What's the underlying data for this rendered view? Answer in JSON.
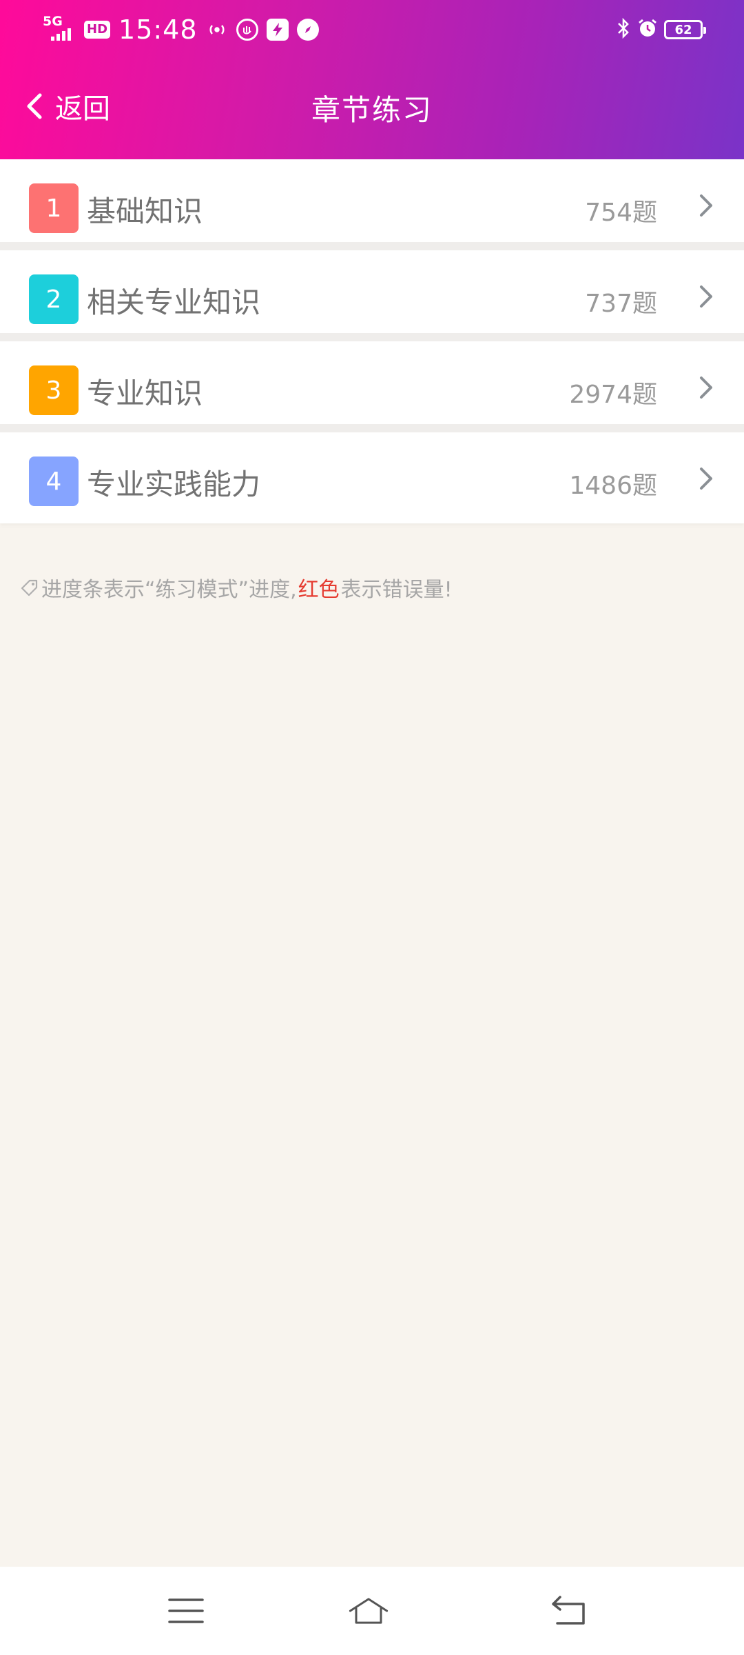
{
  "status_bar": {
    "network": "5G",
    "hd": "HD",
    "time": "15:48",
    "battery": "62"
  },
  "nav": {
    "back_label": "返回",
    "title": "章节练习"
  },
  "chapters": [
    {
      "index": "1",
      "name": "基础知识",
      "count": "754题",
      "color": "#fd7272"
    },
    {
      "index": "2",
      "name": "相关专业知识",
      "count": "737题",
      "color": "#1dcfdb"
    },
    {
      "index": "3",
      "name": "专业知识",
      "count": "2974题",
      "color": "#ffa500"
    },
    {
      "index": "4",
      "name": "专业实践能力",
      "count": "1486题",
      "color": "#86a4ff"
    }
  ],
  "tip": {
    "text_before": "进度条表示“练习模式”进度,",
    "red_text": "红色",
    "text_after": "表示错误量!"
  },
  "colors": {
    "header_start": "#ff0a9a",
    "header_end": "#7a33c8",
    "error_red": "#e53b30"
  }
}
